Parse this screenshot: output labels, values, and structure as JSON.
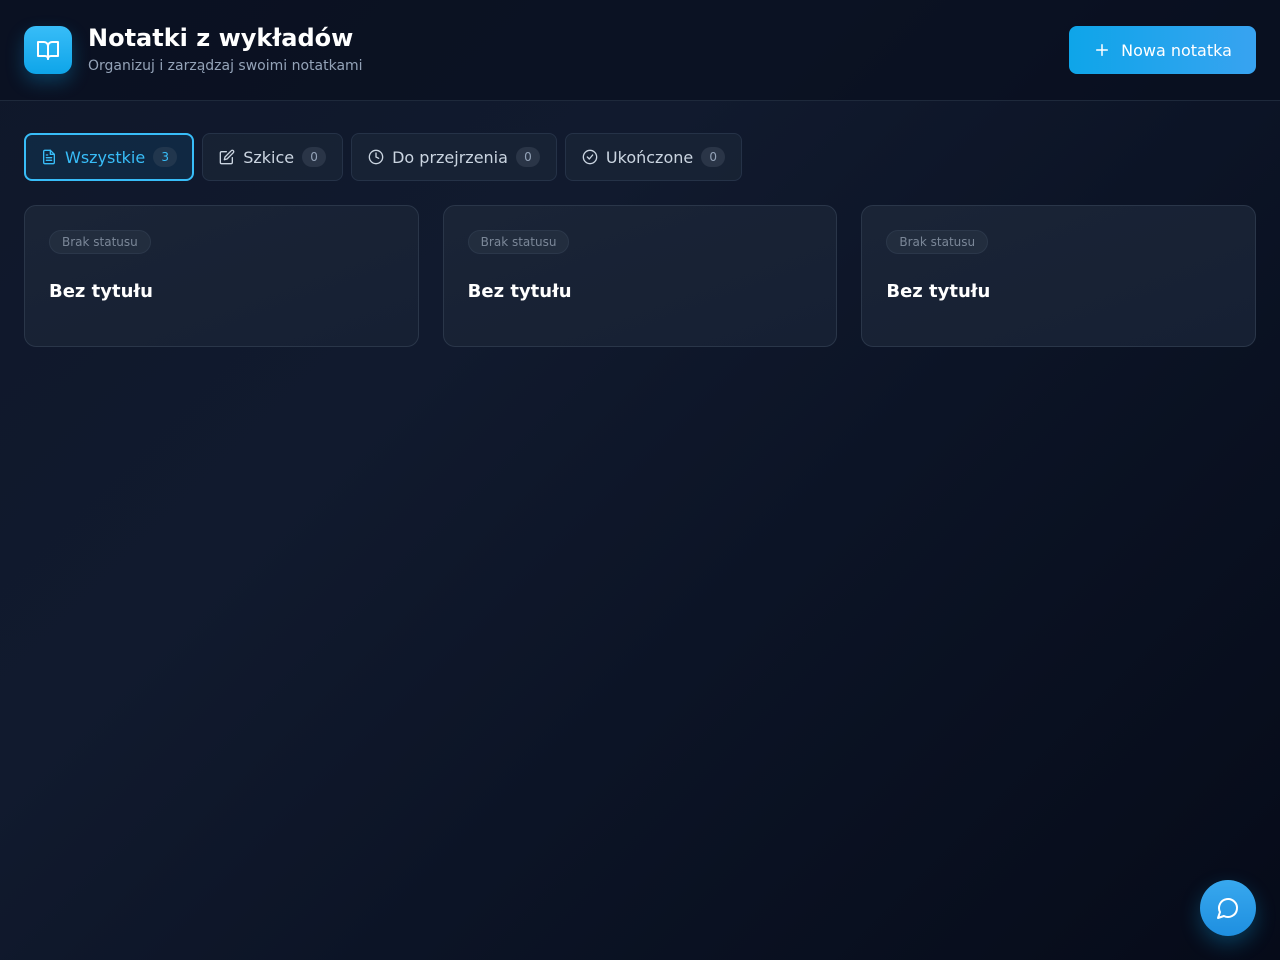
{
  "header": {
    "title": "Notatki z wykładów",
    "subtitle": "Organizuj i zarządzaj swoimi notatkami",
    "logo_icon": "book-open-icon",
    "new_note_label": "Nowa notatka",
    "new_note_icon": "plus-icon"
  },
  "tabs": [
    {
      "label": "Wszystkie",
      "count": "3",
      "icon": "file-text-icon",
      "active": true
    },
    {
      "label": "Szkice",
      "count": "0",
      "icon": "edit-icon",
      "active": false
    },
    {
      "label": "Do przejrzenia",
      "count": "0",
      "icon": "clock-icon",
      "active": false
    },
    {
      "label": "Ukończone",
      "count": "0",
      "icon": "check-circle-icon",
      "active": false
    }
  ],
  "notes": [
    {
      "status": "Brak statusu",
      "title": "Bez tytułu"
    },
    {
      "status": "Brak statusu",
      "title": "Bez tytułu"
    },
    {
      "status": "Brak statusu",
      "title": "Bez tytułu"
    }
  ],
  "chat_button": {
    "icon": "message-circle-icon"
  },
  "colors": {
    "accent": "#38bdf8",
    "background": "#0f172a",
    "card": "#1a2436",
    "button": "#0ea5e9"
  }
}
